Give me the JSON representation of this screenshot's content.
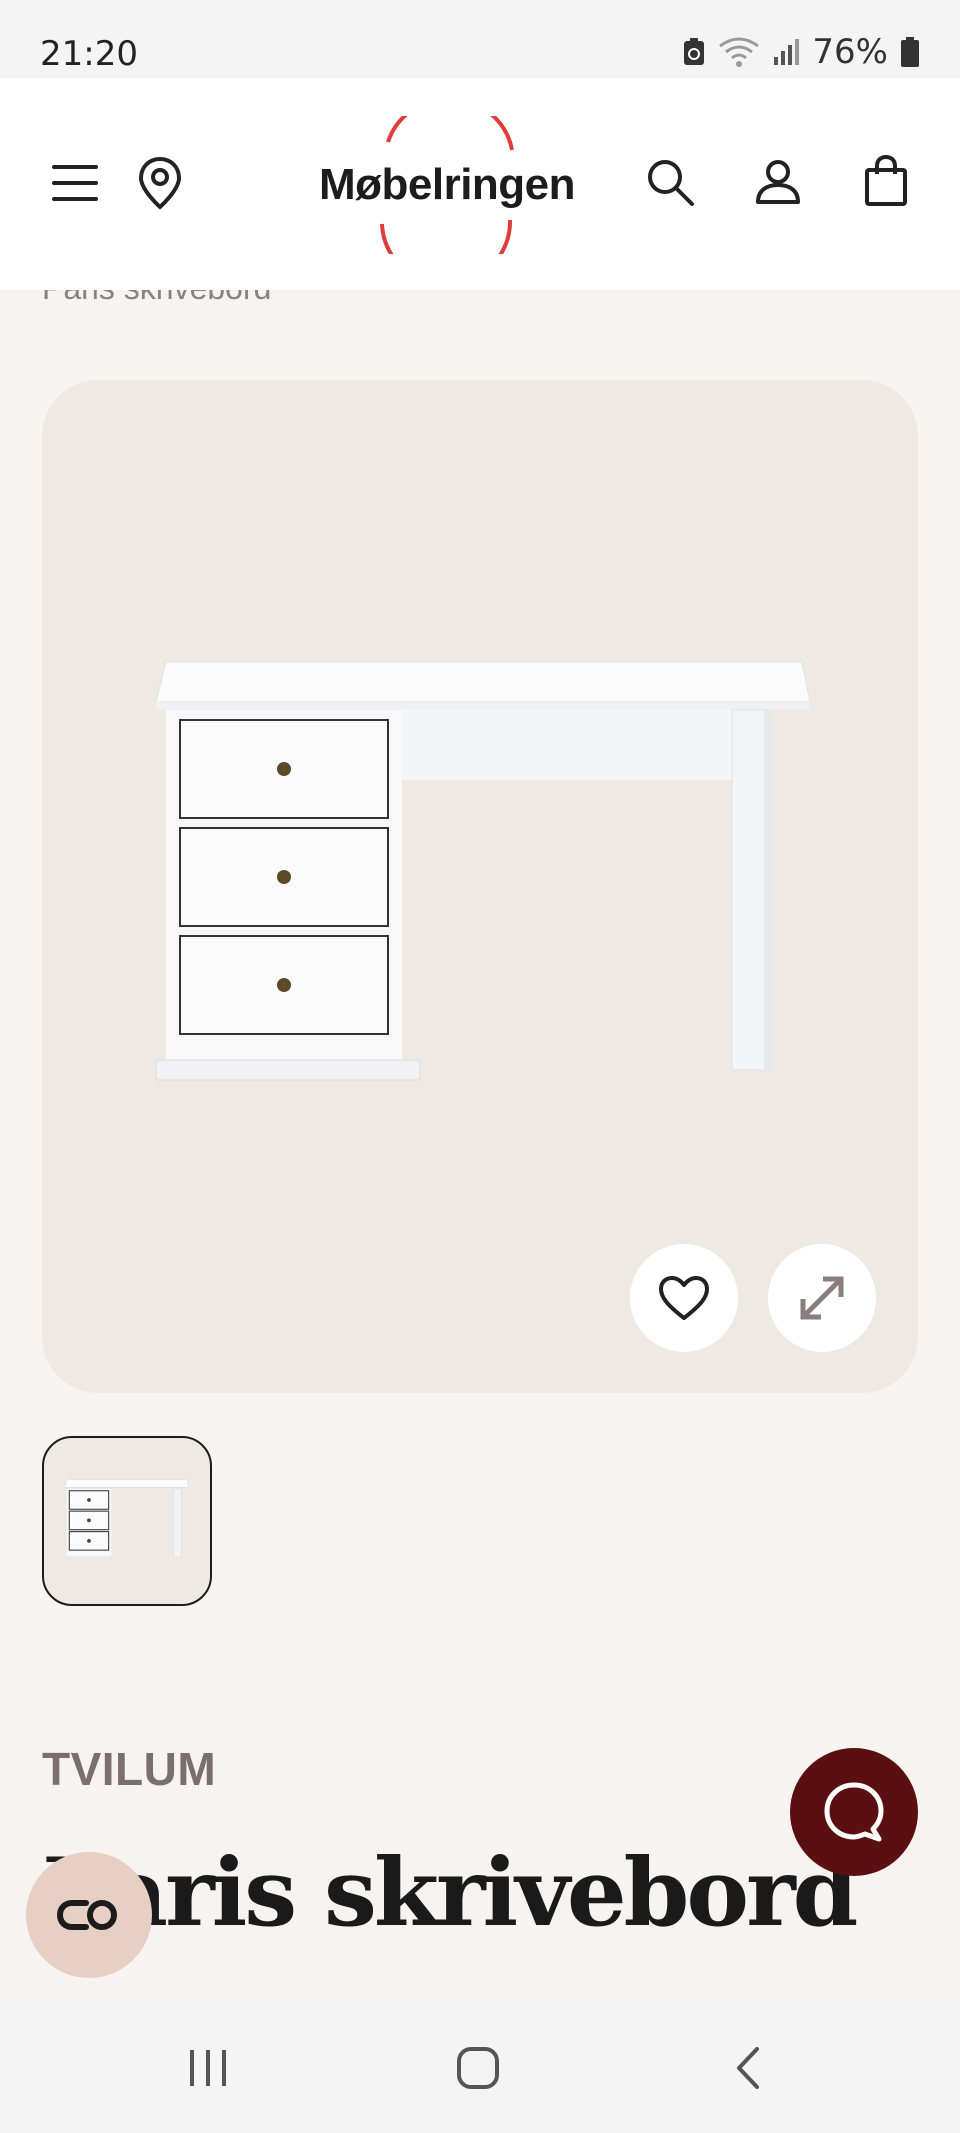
{
  "status_bar": {
    "time": "21:20",
    "battery_percent": "76%",
    "icons": [
      "battery-saver-icon",
      "wifi-icon",
      "signal-icon",
      "battery-icon"
    ]
  },
  "header": {
    "logo_text": "Møbelringen",
    "brand_color": "#e23b3b",
    "icons": [
      "menu-icon",
      "location-pin-icon",
      "search-icon",
      "user-icon",
      "shopping-bag-icon"
    ]
  },
  "breadcrumb": {
    "current": "Paris skrivebord"
  },
  "gallery": {
    "background": "#efe9e3",
    "buttons": [
      "heart-icon",
      "expand-icon"
    ]
  },
  "product": {
    "brand": "TVILUM",
    "title": "Paris skrivebord",
    "title_visible": "ris skrivebord"
  },
  "floating": {
    "chat_color": "#5a1010",
    "accessibility_color": "#e7cfc4"
  },
  "nav_bar": {
    "icons": [
      "recent-apps-icon",
      "home-icon",
      "back-icon"
    ]
  }
}
